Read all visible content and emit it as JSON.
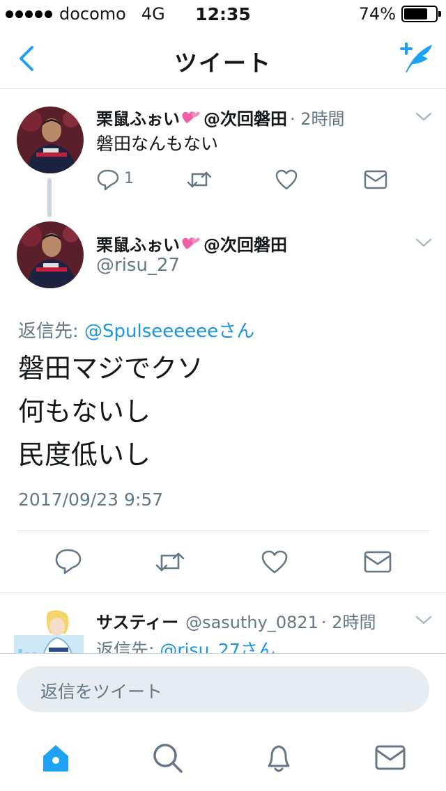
{
  "status_bar": {
    "carrier": "docomo",
    "network": "4G",
    "time": "12:35",
    "battery_percent": "74%",
    "battery_level": 0.74
  },
  "nav": {
    "title": "ツイート",
    "back_icon": "chevron-left-icon",
    "compose_icon": "compose-tweet-icon"
  },
  "tweets": [
    {
      "name": "栗鼠ふぉい",
      "screen": "@次回磐田",
      "time": "· 2時間",
      "text": "磐田なんもない",
      "reply_count": "1"
    },
    {
      "name": "栗鼠ふぉい",
      "screen": "@次回磐田",
      "handle": "@risu_27",
      "reply_to_prefix": "返信先: ",
      "reply_to_user": "@Spulseeeeeeさん",
      "lines": [
        "磐田マジでクソ",
        "何もないし",
        "民度低いし"
      ],
      "timestamp": "2017/09/23 9:57"
    },
    {
      "name": "サスティー",
      "screen": "@sasuthy_0821",
      "time": "· 2時間",
      "reply_to_prefix": "返信先: ",
      "reply_to_user": "@risu_27さん"
    }
  ],
  "composer": {
    "placeholder": "返信をツイート"
  },
  "tabs": [
    "home-icon",
    "search-icon",
    "notifications-icon",
    "messages-icon"
  ],
  "colors": {
    "accent": "#1da1f2",
    "link": "#1b95e0",
    "muted": "#657786",
    "icon_gray": "#657786",
    "divider": "#d8dee2"
  }
}
